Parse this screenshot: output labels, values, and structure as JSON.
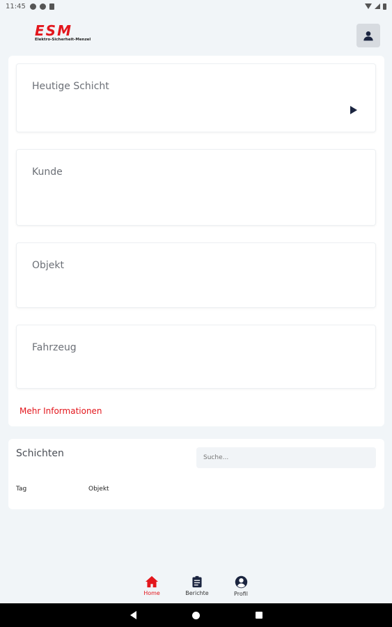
{
  "status_bar": {
    "time": "11:45"
  },
  "header": {
    "logo_text": "ESM",
    "logo_subtitle": "Elektro-Sicherheit-Menzel",
    "profile_icon": "person-icon"
  },
  "shift_card": {
    "fields": [
      {
        "label": "Heutige Schicht"
      },
      {
        "label": "Kunde"
      },
      {
        "label": "Objekt"
      },
      {
        "label": "Fahrzeug"
      }
    ],
    "more_link": "Mehr Informationen"
  },
  "shifts_section": {
    "title": "Schichten",
    "search_placeholder": "Suche...",
    "columns": [
      "Tag",
      "Objekt"
    ]
  },
  "bottom_nav": {
    "items": [
      {
        "label": "Home",
        "icon": "home-icon",
        "active": true
      },
      {
        "label": "Berichte",
        "icon": "clipboard-icon",
        "active": false
      },
      {
        "label": "Profil",
        "icon": "account-circle-icon",
        "active": false
      }
    ]
  },
  "colors": {
    "accent": "#e3161c",
    "dark": "#1b2540",
    "background": "#f1f5f8"
  }
}
